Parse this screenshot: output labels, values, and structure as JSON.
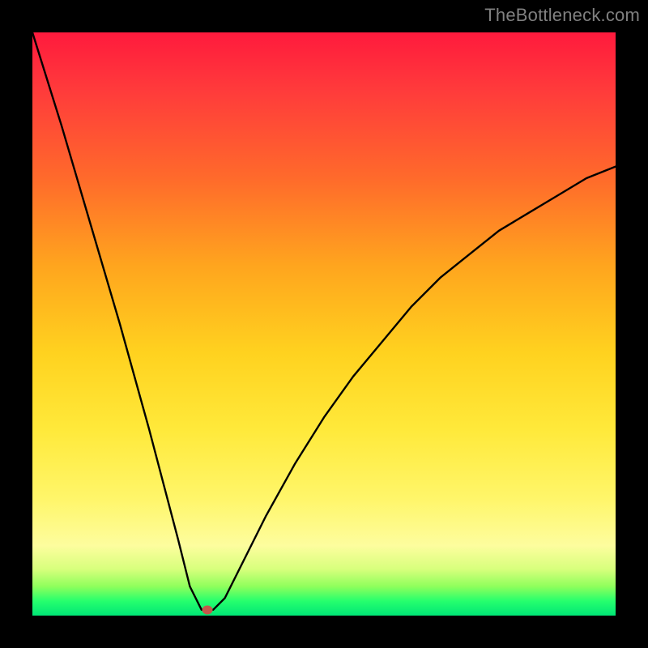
{
  "watermark": "TheBottleneck.com",
  "colors": {
    "frame": "#000000",
    "curve": "#000000",
    "marker": "#c4574b",
    "gradient_top": "#ff1a3d",
    "gradient_bottom": "#00e676"
  },
  "chart_data": {
    "type": "line",
    "title": "",
    "xlabel": "",
    "ylabel": "",
    "xlim": [
      0,
      100
    ],
    "ylim": [
      0,
      100
    ],
    "grid": false,
    "legend": false,
    "series": [
      {
        "name": "bottleneck-curve",
        "x": [
          0,
          5,
          10,
          15,
          20,
          25,
          27,
          29,
          30,
          31,
          33,
          35,
          40,
          45,
          50,
          55,
          60,
          65,
          70,
          75,
          80,
          85,
          90,
          95,
          100
        ],
        "y": [
          100,
          84,
          67,
          50,
          32,
          13,
          5,
          1,
          1,
          1,
          3,
          7,
          17,
          26,
          34,
          41,
          47,
          53,
          58,
          62,
          66,
          69,
          72,
          75,
          77
        ]
      }
    ],
    "marker": {
      "x": 30,
      "y": 1
    },
    "annotations": []
  }
}
